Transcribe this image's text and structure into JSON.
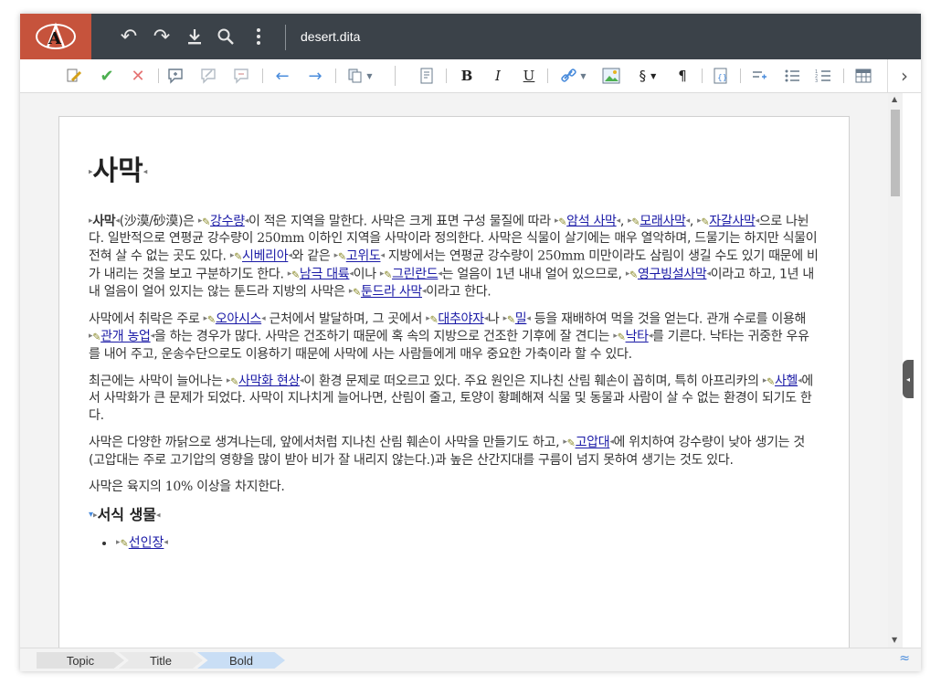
{
  "titlebar": {
    "filename": "desert.dita",
    "icons": [
      "undo-icon",
      "redo-icon",
      "download-icon",
      "search-icon",
      "more-icon"
    ]
  },
  "toolbar": {
    "bold_label": "B",
    "italic_label": "I",
    "underline_label": "U",
    "section_label": "§",
    "pilcrow_label": "¶"
  },
  "document": {
    "title": "사막",
    "paragraphs": [
      [
        {
          "t": "사막",
          "k": "kw"
        },
        {
          "t": "(沙漠/砂漠)은 "
        },
        {
          "t": "강수량",
          "k": "x"
        },
        {
          "t": "이 적은 지역을 말한다. 사막은 크게 표면 구성 물질에 따라 "
        },
        {
          "t": "암석 사막",
          "k": "x"
        },
        {
          "t": ", "
        },
        {
          "t": "모래사막",
          "k": "x"
        },
        {
          "t": ", "
        },
        {
          "t": "자갈사막",
          "k": "x"
        },
        {
          "t": "으로 나뉜다. 일반적으로 연평균 강수량이 "
        },
        {
          "t": "250mm",
          "k": "en"
        },
        {
          "t": " 이하인 지역을 사막이라 정의한다. 사막은 식물이 살기에는 매우 열악하며, 드물기는 하지만 식물이 전혀 살 수 없는 곳도 있다. "
        },
        {
          "t": "시베리아",
          "k": "x"
        },
        {
          "t": "와 같은 "
        },
        {
          "t": "고위도",
          "k": "x"
        },
        {
          "t": " 지방에서는 연평균 강수량이 "
        },
        {
          "t": "250mm",
          "k": "en"
        },
        {
          "t": " 미만이라도 삼림이 생길 수도 있기 때문에 비가 내리는 것을 보고 구분하기도 한다. "
        },
        {
          "t": "남극 대륙",
          "k": "x"
        },
        {
          "t": "이나 "
        },
        {
          "t": "그린란드",
          "k": "x"
        },
        {
          "t": "는 얼음이 1년 내내 얼어 있으므로, "
        },
        {
          "t": "영구빙설사막",
          "k": "x"
        },
        {
          "t": "이라고 하고, 1년 내내 얼음이 얼어 있지는 않는 툰드라 지방의 사막은 "
        },
        {
          "t": "툰드라 사막",
          "k": "x"
        },
        {
          "t": "이라고 한다."
        }
      ],
      [
        {
          "t": "사막에서 취락은 주로 "
        },
        {
          "t": "오아시스",
          "k": "x"
        },
        {
          "t": " 근처에서 발달하며, 그 곳에서 "
        },
        {
          "t": "대추야자",
          "k": "x"
        },
        {
          "t": "나 "
        },
        {
          "t": "밀",
          "k": "x"
        },
        {
          "t": " 등을 재배하여 먹을 것을 얻는다. 관개 수로를 이용해 "
        },
        {
          "t": "관개 농업",
          "k": "x"
        },
        {
          "t": "을 하는 경우가 많다. 사막은 건조하기 때문에 혹 속의 지방으로 건조한 기후에 잘 견디는 "
        },
        {
          "t": "낙타",
          "k": "x"
        },
        {
          "t": "를 기른다. 낙타는 귀중한 우유를 내어 주고, 운송수단으로도 이용하기 때문에 사막에 사는 사람들에게 매우 중요한 가축이라 할 수 있다."
        }
      ],
      [
        {
          "t": "최근에는 사막이 늘어나는 "
        },
        {
          "t": "사막화 현상",
          "k": "x"
        },
        {
          "t": "이 환경 문제로 떠오르고 있다. 주요 원인은 지나친 산림 훼손이 꼽히며, 특히 아프리카의 "
        },
        {
          "t": "사헬",
          "k": "x"
        },
        {
          "t": "에서 사막화가 큰 문제가 되었다. 사막이 지나치게 늘어나면, 산림이 줄고, 토양이 황폐해져 식물 및 동물과 사람이 살 수 없는 환경이 되기도 한다."
        }
      ],
      [
        {
          "t": "사막은 다양한 까닭으로 생겨나는데, 앞에서처럼 지나친 산림 훼손이 사막을 만들기도 하고, "
        },
        {
          "t": "고압대",
          "k": "x"
        },
        {
          "t": "에 위치하여 강수량이 낮아 생기는 것(고압대는 주로 고기압의 영향을 많이 받아 비가 잘 내리지 않는다.)과 높은 산간지대를 구름이 넘지 못하여 생기는 것도 있다."
        }
      ],
      [
        {
          "t": "사막은 육지의 "
        },
        {
          "t": "10%",
          "k": "en"
        },
        {
          "t": " 이상을 차지한다."
        }
      ]
    ],
    "section_title": "서식 생물",
    "list_items": [
      "선인장"
    ]
  },
  "statusbar": {
    "crumbs": [
      "Topic",
      "Title",
      "Bold"
    ]
  },
  "colors": {
    "titlebar_bg": "#3b4249",
    "logo_bg": "#c6533c",
    "link": "#1a1aa6",
    "accept": "#4caf50",
    "reject": "#e57373",
    "arrows": "#4a8cdc"
  }
}
